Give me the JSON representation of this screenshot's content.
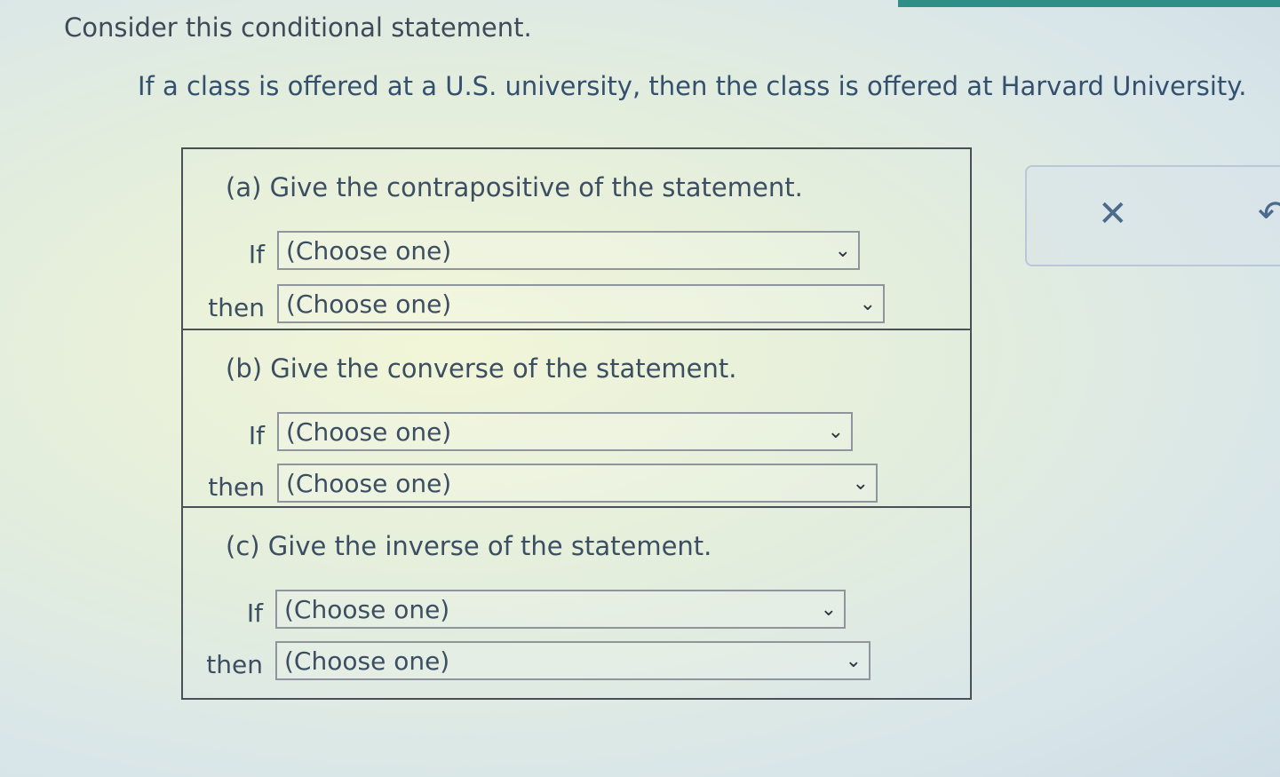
{
  "intro": "Consider this conditional statement.",
  "statement": "If a class is offered at a U.S. university, then the class is offered at Harvard University.",
  "parts": [
    {
      "prompt": "(a) Give the contrapositive of the statement.",
      "if_label": "If",
      "then_label": "then",
      "if_value": "(Choose one)",
      "then_value": "(Choose one)"
    },
    {
      "prompt": "(b) Give the converse of the statement.",
      "if_label": "If",
      "then_label": "then",
      "if_value": "(Choose one)",
      "then_value": "(Choose one)"
    },
    {
      "prompt": "(c) Give the inverse of the statement.",
      "if_label": "If",
      "then_label": "then",
      "if_value": "(Choose one)",
      "then_value": "(Choose one)"
    }
  ],
  "actions": {
    "close_icon": "close-icon",
    "undo_icon": "undo-icon",
    "close_glyph": "✕",
    "undo_glyph": "↶"
  },
  "colors": {
    "accent": "#2f8f86",
    "text": "#3c4e62",
    "border": "#4a5058"
  }
}
